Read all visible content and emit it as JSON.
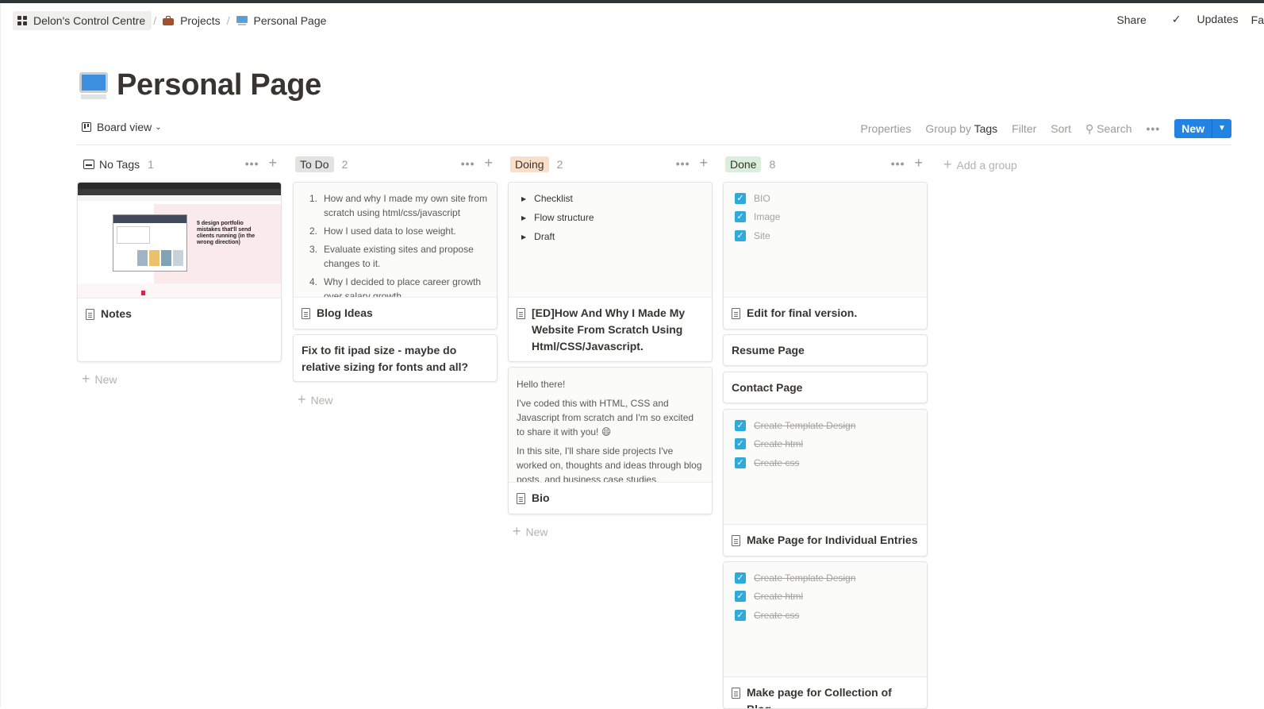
{
  "breadcrumbs": [
    {
      "label": "Delon's Control Centre",
      "icon": "grid-icon"
    },
    {
      "label": "Projects",
      "icon": "briefcase-icon"
    },
    {
      "label": "Personal Page",
      "icon": "computer-icon"
    }
  ],
  "topbar": {
    "share": "Share",
    "updates": "Updates",
    "favorite": "Fa"
  },
  "page": {
    "title": "Personal Page",
    "icon": "computer-icon"
  },
  "view": {
    "name": "Board view",
    "properties": "Properties",
    "group_by_label": "Group by",
    "group_by_value": "Tags",
    "filter": "Filter",
    "sort": "Sort",
    "search": "Search",
    "new": "New"
  },
  "colors": {
    "accent": "#2383e2",
    "checkbox": "#2eaadc",
    "todo_tag": "#e3e2e0",
    "doing_tag": "#fadec9",
    "done_tag": "#dbeddb"
  },
  "columns": [
    {
      "name": "No Tags",
      "count": "1",
      "cards": [
        {
          "title": "Notes",
          "preview_text": "5 design portfolio mistakes that'll send clients running (in the wrong direction)"
        }
      ]
    },
    {
      "name": "To Do",
      "count": "2",
      "cards": [
        {
          "title": "Blog Ideas",
          "list": [
            {
              "n": "1.",
              "text": "How and why I made my own site from scratch using html/css/javascript"
            },
            {
              "n": "2.",
              "text": "How I used data to lose weight."
            },
            {
              "n": "3.",
              "text": "Evaluate existing sites and propose changes to it."
            },
            {
              "n": "4.",
              "text": "Why I decided to place career growth over salary growth"
            }
          ]
        },
        {
          "title": "Fix to fit ipad size - maybe do relative sizing for fonts and all?"
        }
      ]
    },
    {
      "name": "Doing",
      "count": "2",
      "cards": [
        {
          "title": "[ED]How And Why I Made My Website From Scratch Using Html/CSS/Javascript.",
          "toggles": [
            "Checklist",
            "Flow structure",
            "Draft"
          ]
        },
        {
          "title": "Bio",
          "paragraphs": [
            "Hello there!",
            "I've coded this with HTML, CSS and Javascript from scratch and I'm so excited to share it with you! 😄",
            "In this site, I'll share side projects I've worked on, thoughts and ideas through blog posts, and business case studies."
          ]
        }
      ]
    },
    {
      "name": "Done",
      "count": "8",
      "cards": [
        {
          "title": "Edit for final version.",
          "checks": [
            "BIO",
            "Image",
            "Site"
          ]
        },
        {
          "title": "Resume Page"
        },
        {
          "title": "Contact Page"
        },
        {
          "title": "Make Page for Individual Entries",
          "checks": [
            "Create Template Design",
            "Create html",
            "Create css"
          ]
        },
        {
          "title": "Make page for Collection of Blog.",
          "checks": [
            "Create Template Design",
            "Create html",
            "Create css"
          ]
        }
      ]
    }
  ],
  "add_new": "New",
  "add_group": "Add a group"
}
